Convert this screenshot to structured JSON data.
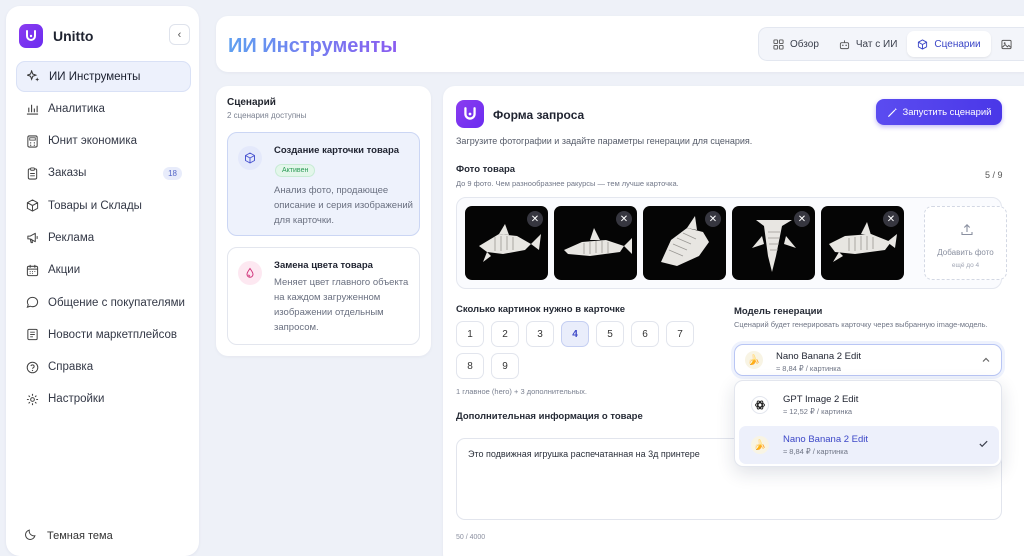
{
  "brand": {
    "name": "Unitto"
  },
  "sidebar": {
    "items": [
      {
        "label": "ИИ Инструменты",
        "icon": "sparkles-icon",
        "active": true
      },
      {
        "label": "Аналитика",
        "icon": "bar-chart-icon"
      },
      {
        "label": "Юнит экономика",
        "icon": "calculator-icon"
      },
      {
        "label": "Заказы",
        "icon": "clipboard-icon",
        "badge": "18"
      },
      {
        "label": "Товары и Склады",
        "icon": "box-icon"
      },
      {
        "label": "Реклама",
        "icon": "megaphone-icon"
      },
      {
        "label": "Акции",
        "icon": "calendar-icon"
      },
      {
        "label": "Общение с покупателями",
        "icon": "chat-icon"
      },
      {
        "label": "Новости маркетплейсов",
        "icon": "newspaper-icon"
      },
      {
        "label": "Справка",
        "icon": "help-circle-icon"
      },
      {
        "label": "Настройки",
        "icon": "gear-icon"
      }
    ],
    "theme_label": "Темная тема"
  },
  "header": {
    "title": "ИИ Инструменты",
    "tabs": [
      {
        "label": "Обзор",
        "icon": "grid-icon"
      },
      {
        "label": "Чат с ИИ",
        "icon": "robot-icon"
      },
      {
        "label": "Сценарии",
        "icon": "cube-icon",
        "active": true
      }
    ]
  },
  "scenarios": {
    "title": "Сценарий",
    "subtitle": "2 сценария доступны",
    "cards": [
      {
        "title": "Создание карточки товара",
        "status": "Активен",
        "description": "Анализ фото, продающее описание и серия изображений для карточки."
      },
      {
        "title": "Замена цвета товара",
        "description": "Меняет цвет главного объекта на каждом загруженном изображении отдельным запросом."
      }
    ]
  },
  "form": {
    "title": "Форма запроса",
    "run_button": "Запустить сценарий",
    "description": "Загрузите фотографии и задайте параметры генерации для сценария.",
    "photos": {
      "label": "Фото товара",
      "hint": "До 9 фото. Чем разнообразнее ракурсы — тем лучше карточка.",
      "count": "5 / 9",
      "add_label": "Добавить фото",
      "add_hint": "ещё до 4",
      "remove_symbol": "✕"
    },
    "image_count": {
      "label": "Сколько картинок нужно в карточке",
      "options": [
        "1",
        "2",
        "3",
        "4",
        "5",
        "6",
        "7",
        "8",
        "9"
      ],
      "selected": "4",
      "hint": "1 главное (hero) + 3 дополнительных."
    },
    "model": {
      "label": "Модель генерации",
      "hint": "Сценарий будет генерировать карточку через выбранную image-модель.",
      "selected_name": "Nano Banana 2 Edit",
      "selected_price": "≈ 8,84 ₽ / картинка",
      "options": [
        {
          "name": "GPT Image 2 Edit",
          "price": "≈ 12,52 ₽ / картинка",
          "icon": "openai-icon"
        },
        {
          "name": "Nano Banana 2 Edit",
          "price": "≈ 8,84 ₽ / картинка",
          "icon": "banana-icon",
          "selected": true
        }
      ]
    },
    "extra_info": {
      "label": "Дополнительная информация о товаре",
      "value": "Это подвижная игрушка распечатанная на 3д принтере",
      "counter": "50 / 4000"
    }
  },
  "colors": {
    "accent": "#4a37e8",
    "brand_gradient_start": "#8b3cf0",
    "title_gradient_start": "#5fa0f0",
    "title_gradient_end": "#8a5cf0",
    "active_status": "#2a9a55"
  }
}
